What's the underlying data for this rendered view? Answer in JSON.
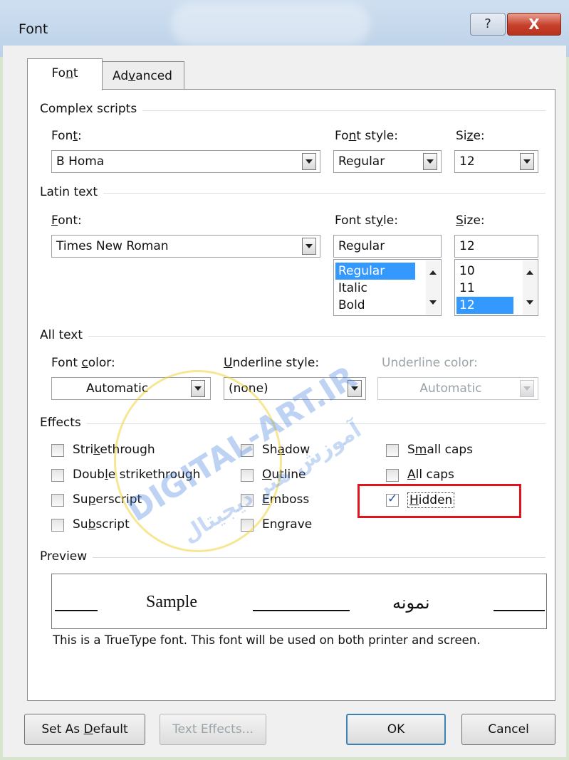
{
  "window": {
    "title": "Font",
    "help_glyph": "?",
    "close_glyph": "X"
  },
  "tabs": [
    {
      "pre": "Fo",
      "acc": "n",
      "post": "t"
    },
    {
      "pre": "Ad",
      "acc": "v",
      "post": "anced"
    }
  ],
  "complex_scripts": {
    "heading": "Complex scripts",
    "font_label": {
      "pre": "Fon",
      "acc": "t",
      "post": ":"
    },
    "font_value": "B Homa",
    "style_label": {
      "pre": "Fo",
      "acc": "n",
      "post": "t style:"
    },
    "style_value": "Regular",
    "size_label": {
      "pre": "Si",
      "acc": "z",
      "post": "e:"
    },
    "size_value": "12"
  },
  "latin_text": {
    "heading": "Latin text",
    "font_label": {
      "pre": "",
      "acc": "F",
      "post": "ont:"
    },
    "font_value": "Times New Roman",
    "style_label": {
      "pre": "Font st",
      "acc": "y",
      "post": "le:"
    },
    "style_value": "Regular",
    "style_options": [
      "Regular",
      "Italic",
      "Bold"
    ],
    "size_label": {
      "pre": "",
      "acc": "S",
      "post": "ize:"
    },
    "size_value": "12",
    "size_options": [
      "10",
      "11",
      "12"
    ]
  },
  "all_text": {
    "heading": "All text",
    "color_label": {
      "pre": "Font ",
      "acc": "c",
      "post": "olor:"
    },
    "color_value": "Automatic",
    "underline_style_label": {
      "pre": "",
      "acc": "U",
      "post": "nderline style:"
    },
    "underline_style_value": "(none)",
    "underline_color_label": "Underline color:",
    "underline_color_value": "Automatic"
  },
  "effects": {
    "heading": "Effects",
    "strikethrough": {
      "pre": "Stri",
      "acc": "k",
      "post": "ethrough",
      "checked": false
    },
    "double_strikethrough": {
      "pre": "Doub",
      "acc": "l",
      "post": "e strikethrough",
      "checked": false
    },
    "superscript": {
      "pre": "Su",
      "acc": "p",
      "post": "erscript",
      "checked": false
    },
    "subscript": {
      "pre": "Su",
      "acc": "b",
      "post": "script",
      "checked": false
    },
    "shadow": {
      "pre": "Sh",
      "acc": "a",
      "post": "dow",
      "checked": false
    },
    "outline": {
      "pre": "",
      "acc": "O",
      "post": "utline",
      "checked": false
    },
    "emboss": {
      "pre": "",
      "acc": "E",
      "post": "mboss",
      "checked": false
    },
    "engrave": {
      "pre": "En",
      "acc": "g",
      "post": "rave",
      "checked": false
    },
    "small_caps": {
      "pre": "S",
      "acc": "m",
      "post": "all caps",
      "checked": false
    },
    "all_caps": {
      "pre": "",
      "acc": "A",
      "post": "ll caps",
      "checked": false
    },
    "hidden": {
      "pre": "",
      "acc": "H",
      "post": "idden",
      "checked": true
    },
    "check_glyph": "✓"
  },
  "preview": {
    "heading": "Preview",
    "latin_sample": "Sample",
    "complex_sample": "نمونه",
    "note": "This is a TrueType font. This font will be used on both printer and screen."
  },
  "buttons": {
    "set_default": {
      "pre": "Set As ",
      "acc": "D",
      "post": "efault"
    },
    "text_effects": "Text Effects...",
    "ok": "OK",
    "cancel": "Cancel"
  },
  "watermark": {
    "latin": "DIGITAL-ART.IR",
    "persian": "آموزش هنر دیجیتال"
  },
  "colors": {
    "accent": "#3399ff",
    "highlight_box": "#e0141d",
    "close_button": "#c7402c"
  }
}
